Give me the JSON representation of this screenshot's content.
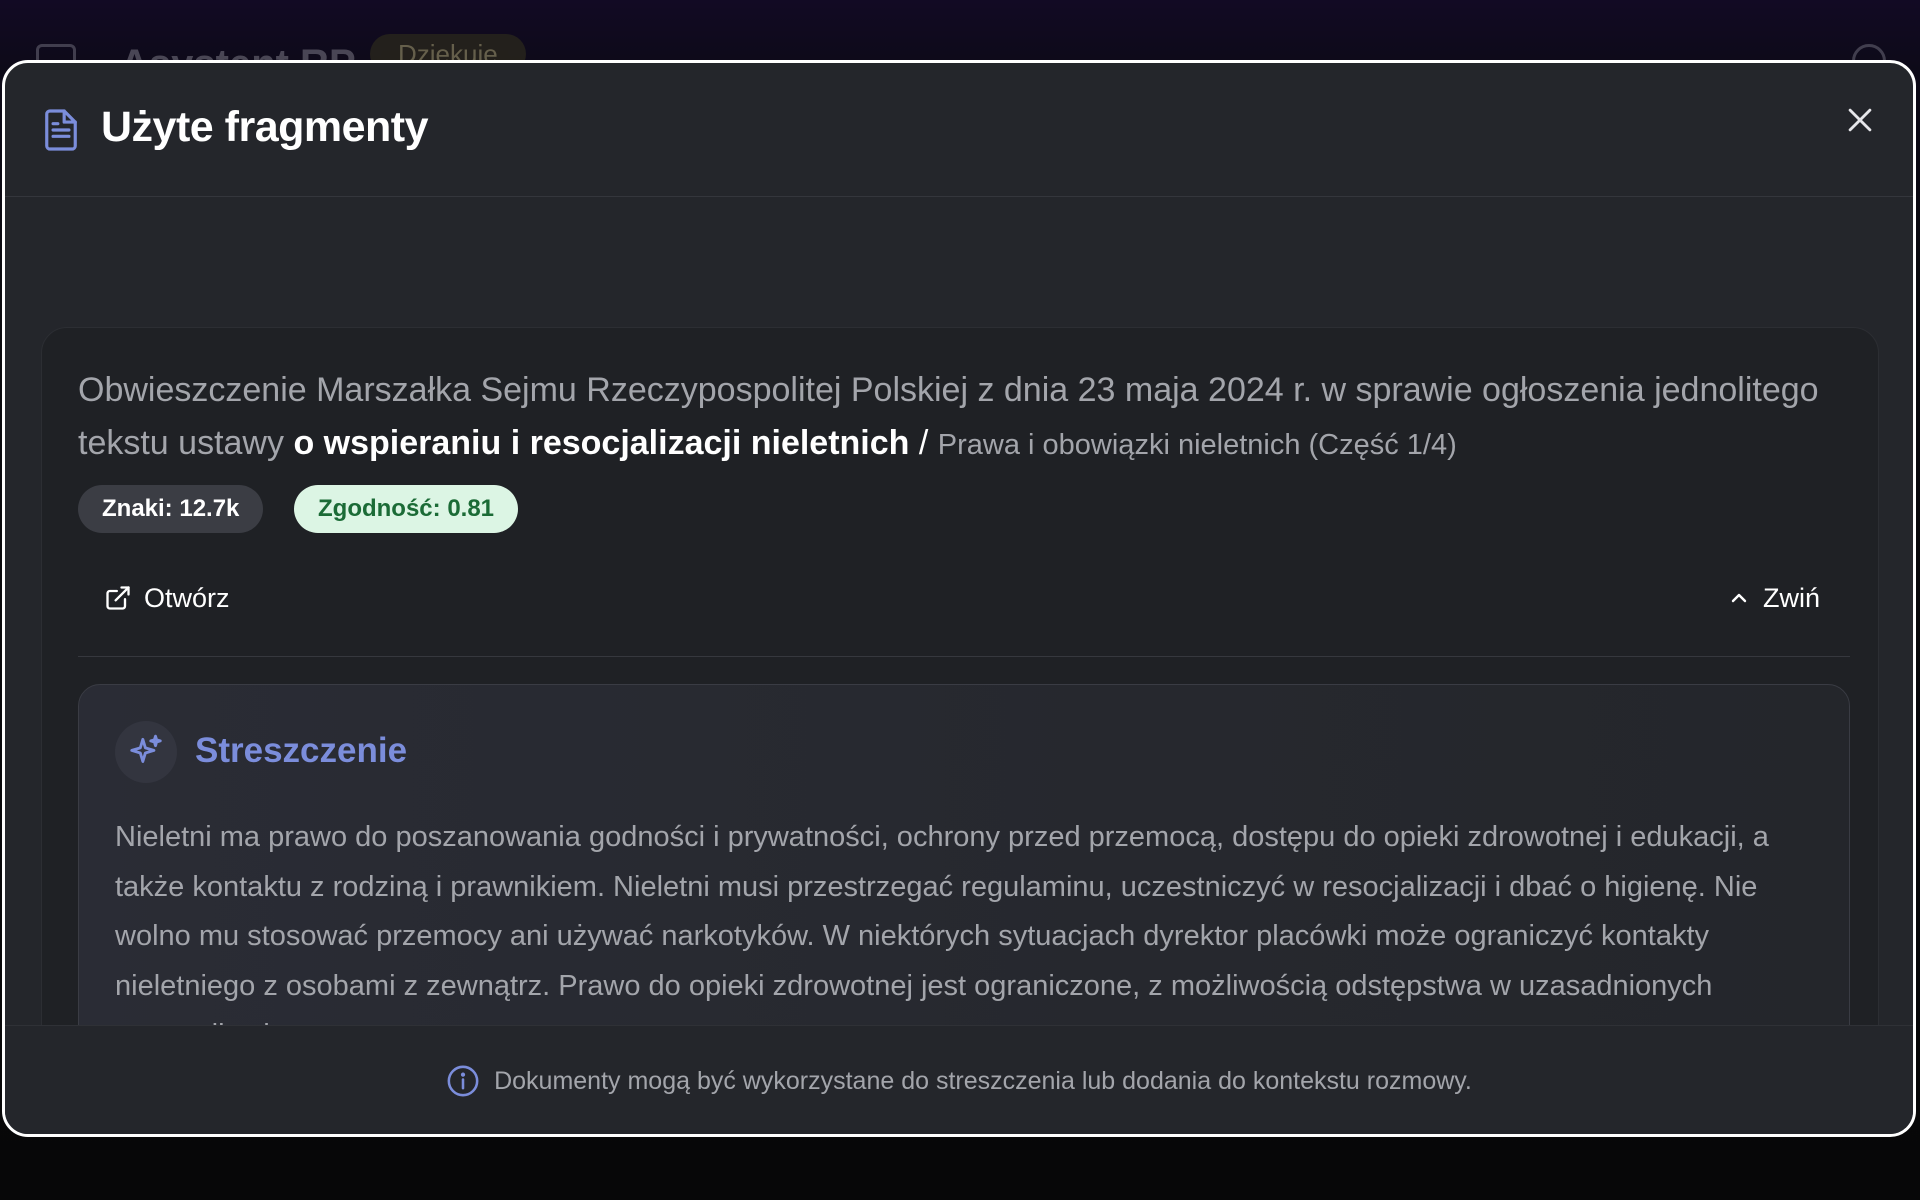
{
  "background": {
    "app_title": "Asystent RP",
    "badge_label": "Dziękuję"
  },
  "modal": {
    "title": "Użyte fragmenty",
    "close_icon": "close-icon",
    "header_icon": "document-icon"
  },
  "document": {
    "title_prefix": "Obwieszczenie Marszałka Sejmu Rzeczypospolitej Polskiej z dnia 23 maja 2024 r. w sprawie ogłoszenia jednolitego tekstu ustawy",
    "title_strong": "o wspieraniu i resocjalizacji nieletnich",
    "title_separator": "/",
    "title_section": "Prawa i obowiązki nieletnich (Część 1/4)",
    "chip_chars": "Znaki: 12.7k",
    "chip_match": "Zgodność: 0.81",
    "open_label": "Otwórz",
    "open_icon": "external-link-icon",
    "collapse_label": "Zwiń",
    "collapse_icon": "chevron-up-icon"
  },
  "summary": {
    "heading": "Streszczenie",
    "icon": "sparkles-icon",
    "text": "Nieletni ma prawo do poszanowania godności i prywatności, ochrony przed przemocą, dostępu do opieki zdrowotnej i edukacji, a także kontaktu z rodziną i prawnikiem. Nieletni musi przestrzegać regulaminu, uczestniczyć w resocjalizacji i dbać o higienę. Nie wolno mu stosować przemocy ani używać narkotyków. W niektórych sytuacjach dyrektor placówki może ograniczyć kontakty nieletniego z osobami z zewnątrz. Prawo do opieki zdrowotnej jest ograniczone, z możliwością odstępstwa w uzasadnionych przypadkach."
  },
  "footer": {
    "icon": "info-icon",
    "text": "Dokumenty mogą być wykorzystane do streszczenia lub dodania do kontekstu rozmowy."
  },
  "colors": {
    "modal_bg": "#24262b",
    "card_bg": "#1f2125",
    "accent": "#7b8ddb",
    "match_chip_bg": "#dcf5e4",
    "match_chip_text": "#1b6b36"
  }
}
